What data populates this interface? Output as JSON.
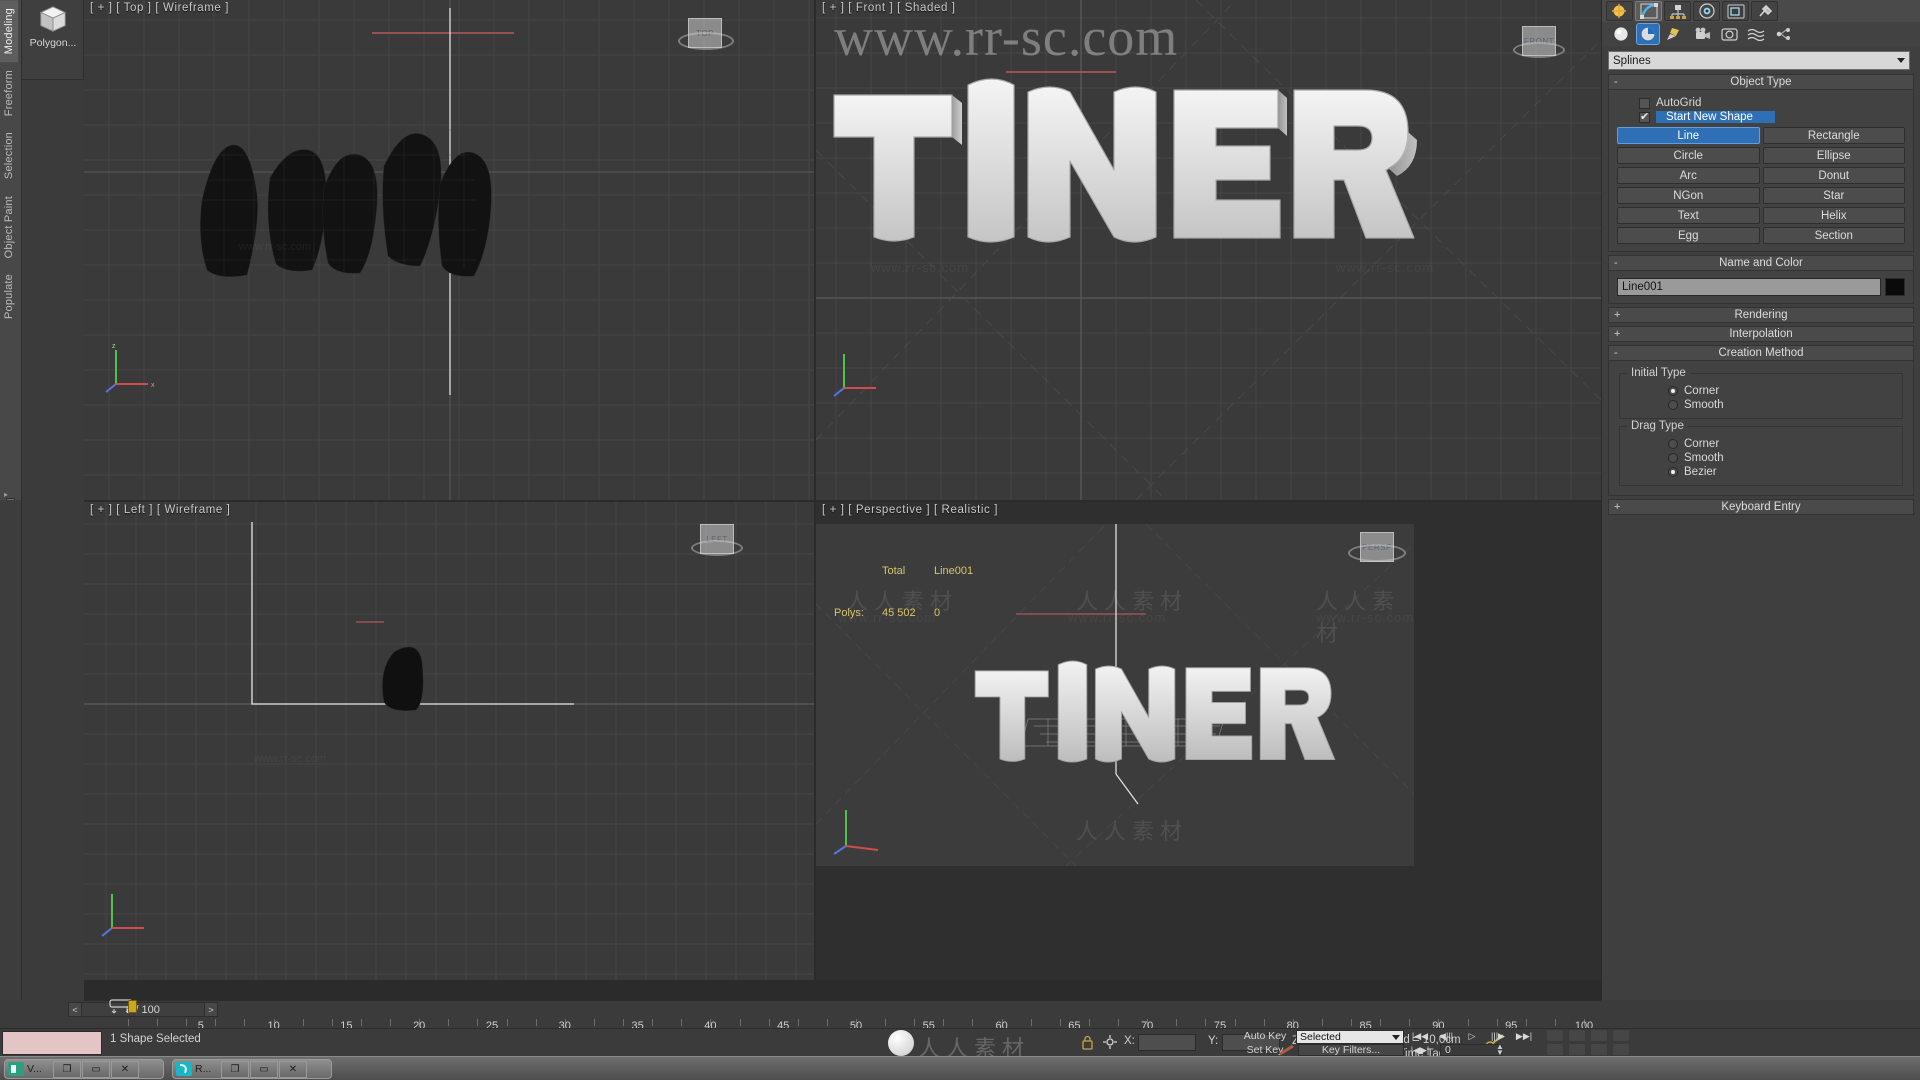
{
  "ribbon": {
    "tabs": [
      {
        "label": "Modeling",
        "active": true
      },
      {
        "label": "Freeform",
        "active": false
      },
      {
        "label": "Selection",
        "active": false
      },
      {
        "label": "Object Paint",
        "active": false
      },
      {
        "label": "Populate",
        "active": false
      }
    ],
    "polygon_button": {
      "label": "Polygon...",
      "icon": "cube-icon"
    }
  },
  "viewports": [
    {
      "key": "top",
      "label": "[ + ] [ Top ] [ Wireframe ]",
      "active": false
    },
    {
      "key": "front",
      "label": "[ + ] [ Front ] [ Shaded ]",
      "active": false
    },
    {
      "key": "left",
      "label": "[ + ] [ Left ] [ Wireframe ]",
      "active": false
    },
    {
      "key": "perspective",
      "label": "[ + ] [ Perspective ] [ Realistic ]",
      "active": true
    }
  ],
  "viewcubes": {
    "top": "TOP",
    "front": "FRONT",
    "left": "LEFT",
    "persp": "PERSP"
  },
  "watermarks": {
    "site": "www.rr-sc.com",
    "big": "www.rr-sc.com",
    "cn": "人人素材"
  },
  "stats": {
    "col_total": "Total",
    "col_object": "Line001",
    "row_label": "Polys:",
    "total_value": "45 502",
    "object_value": "0"
  },
  "command_panel": {
    "tabs": [
      {
        "name": "create-tab",
        "icon": "create-icon",
        "active": true
      },
      {
        "name": "modify-tab",
        "icon": "modify-icon",
        "active": false
      },
      {
        "name": "hierarchy-tab",
        "icon": "hierarchy-icon",
        "active": false
      },
      {
        "name": "motion-tab",
        "icon": "motion-icon",
        "active": false
      },
      {
        "name": "display-tab",
        "icon": "display-icon",
        "active": false
      },
      {
        "name": "utilities-tab",
        "icon": "utilities-icon",
        "active": false
      }
    ],
    "create_tools": [
      {
        "name": "geometry-tool",
        "icon": "sphere-icon",
        "selected": false
      },
      {
        "name": "shapes-tool",
        "icon": "shapes-icon",
        "selected": true
      },
      {
        "name": "lights-tool",
        "icon": "light-icon",
        "selected": false
      },
      {
        "name": "cameras-tool",
        "icon": "camera-icon",
        "selected": false
      },
      {
        "name": "helpers-tool",
        "icon": "tape-icon",
        "selected": false
      },
      {
        "name": "space-warps-tool",
        "icon": "wave-icon",
        "selected": false
      },
      {
        "name": "systems-tool",
        "icon": "systems-icon",
        "selected": false
      }
    ],
    "category": "Splines",
    "object_type": {
      "title": "Object Type",
      "collapse": "-",
      "autogrid": {
        "label": "AutoGrid",
        "checked": false
      },
      "start_new_shape": {
        "label": "Start New Shape",
        "checked": true
      },
      "buttons": [
        {
          "label": "Line",
          "active": true
        },
        {
          "label": "Rectangle",
          "active": false
        },
        {
          "label": "Circle",
          "active": false
        },
        {
          "label": "Ellipse",
          "active": false
        },
        {
          "label": "Arc",
          "active": false
        },
        {
          "label": "Donut",
          "active": false
        },
        {
          "label": "NGon",
          "active": false
        },
        {
          "label": "Star",
          "active": false
        },
        {
          "label": "Text",
          "active": false
        },
        {
          "label": "Helix",
          "active": false
        },
        {
          "label": "Egg",
          "active": false
        },
        {
          "label": "Section",
          "active": false
        }
      ]
    },
    "name_and_color": {
      "title": "Name and Color",
      "collapse": "-",
      "name": "Line001",
      "color": "#060606"
    },
    "rendering": {
      "title": "Rendering",
      "collapse": "+"
    },
    "interpolation": {
      "title": "Interpolation",
      "collapse": "+"
    },
    "creation_method": {
      "title": "Creation Method",
      "collapse": "-",
      "initial_type": {
        "label": "Initial Type",
        "options": [
          {
            "label": "Corner",
            "selected": true
          },
          {
            "label": "Smooth",
            "selected": false
          }
        ]
      },
      "drag_type": {
        "label": "Drag Type",
        "options": [
          {
            "label": "Corner",
            "selected": false
          },
          {
            "label": "Smooth",
            "selected": false
          },
          {
            "label": "Bezier",
            "selected": true
          }
        ]
      }
    },
    "keyboard_entry": {
      "title": "Keyboard Entry",
      "collapse": "+"
    }
  },
  "timeline": {
    "current": "0 / 100",
    "prev_label": "<",
    "next_label": ">",
    "ticks": [
      "5",
      "10",
      "15",
      "20",
      "25",
      "30",
      "35",
      "40",
      "45",
      "50",
      "55",
      "60",
      "65",
      "70",
      "75",
      "80",
      "85",
      "90",
      "95",
      "100"
    ]
  },
  "status_bar": {
    "prompt": "1 Shape Selected",
    "x_label": "X:",
    "x_value": "",
    "y_label": "Y:",
    "y_value": "",
    "z_label": "Z:",
    "z_value": "",
    "grid": "Grid = 10,0cm",
    "add_time_tag": "Add Time Tag",
    "lock_icon": "lock-icon",
    "selection-lock": "selection-lock-icon"
  },
  "animation": {
    "auto_key": "Auto Key",
    "set_key": "Set Key",
    "key_mode": "Selected",
    "key_filters": "Key Filters...",
    "frame": "0",
    "nav": [
      "go-to-start",
      "previous-frame",
      "play",
      "next-frame",
      "go-to-end"
    ]
  },
  "taskbar": {
    "windows": [
      {
        "title": "V...",
        "icon": "vray-icon",
        "buttons": [
          "❐",
          "▭",
          "✕"
        ]
      },
      {
        "title": "R...",
        "icon": "render-icon",
        "buttons": [
          "❐",
          "▭",
          "✕"
        ]
      }
    ]
  }
}
